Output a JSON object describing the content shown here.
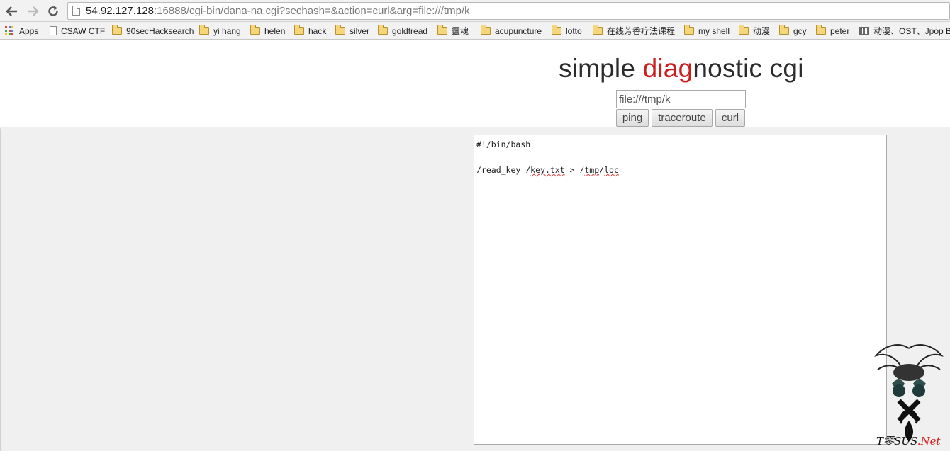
{
  "browser": {
    "url": {
      "host": "54.92.127.128",
      "rest": ":16888/cgi-bin/dana-na.cgi?sechash=&action=curl&arg=file:///tmp/k"
    },
    "bookmarks": [
      {
        "label": "Apps",
        "icon": "apps-icon"
      },
      {
        "label": "CSAW CTF",
        "icon": "page-icon"
      },
      {
        "label": "90secHacksearch",
        "icon": "folder-icon"
      },
      {
        "label": "yi hang",
        "icon": "folder-icon"
      },
      {
        "label": "helen",
        "icon": "folder-icon"
      },
      {
        "label": "hack",
        "icon": "folder-icon"
      },
      {
        "label": "silver",
        "icon": "folder-icon"
      },
      {
        "label": "goldtread",
        "icon": "folder-icon"
      },
      {
        "label": "靈魂",
        "icon": "folder-icon"
      },
      {
        "label": "acupuncture",
        "icon": "folder-icon"
      },
      {
        "label": "lotto",
        "icon": "folder-icon"
      },
      {
        "label": "在线芳香疗法课程",
        "icon": "folder-icon"
      },
      {
        "label": "my shell",
        "icon": "folder-icon"
      },
      {
        "label": "动漫",
        "icon": "folder-icon"
      },
      {
        "label": "gcy",
        "icon": "folder-icon"
      },
      {
        "label": "peter",
        "icon": "folder-icon"
      },
      {
        "label": "动漫、OST、Jpop B...",
        "icon": "pattern-icon"
      }
    ]
  },
  "page": {
    "title_part1": "simple ",
    "title_part2": "diag",
    "title_part3": "nostic cgi",
    "arg_value": "file:///tmp/k",
    "buttons": {
      "ping": "ping",
      "traceroute": "traceroute",
      "curl": "curl"
    },
    "output": {
      "line1": "#!/bin/bash",
      "line2_a": "/read_key /",
      "line2_b": "key.txt",
      "line2_c": " > /",
      "line2_d": "tmp",
      "line2_e": "/",
      "line2_f": "loc"
    }
  },
  "watermark": {
    "text_a": "T",
    "text_b": "零",
    "text_c": "S",
    "text_d": "US",
    "text_e": ".Net"
  },
  "colors": {
    "title_accent": "#cc1d1d",
    "title_text": "#2b2b2b"
  }
}
